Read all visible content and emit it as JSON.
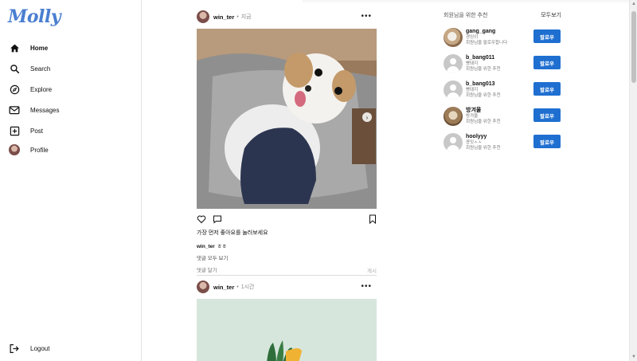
{
  "brand": {
    "logo": "Molly"
  },
  "sidebar": {
    "items": [
      {
        "label": "Home",
        "icon": "home-icon"
      },
      {
        "label": "Search",
        "icon": "search-icon"
      },
      {
        "label": "Explore",
        "icon": "compass-icon"
      },
      {
        "label": "Messages",
        "icon": "mail-icon"
      },
      {
        "label": "Post",
        "icon": "plus-square-icon"
      },
      {
        "label": "Profile",
        "icon": "avatar"
      }
    ],
    "logout": {
      "label": "Logout",
      "icon": "logout-icon"
    }
  },
  "posts": [
    {
      "username": "win_ter",
      "separator": "•",
      "time": "지금",
      "more": "•••",
      "likes_text": "가장 먼저 좋아요를 눌러보세요",
      "caption_user": "win_ter",
      "caption_text": "ㅎㅎ",
      "view_comments": "댓글 모두 보기",
      "comment_placeholder": "댓글 달기",
      "comment_post": "게시"
    },
    {
      "username": "win_ter",
      "separator": "•",
      "time": "1시간",
      "more": "•••"
    }
  ],
  "suggestions": {
    "title": "회원님을 위한 추천",
    "see_all": "모두보기",
    "follow_label": "팔로우",
    "items": [
      {
        "name": "gang_gang",
        "sub1": "경잉이",
        "sub2": "회원님을 팔로우합니다",
        "avatar": "photo1"
      },
      {
        "name": "b_bang011",
        "sub1": "빵돼지",
        "sub2": "회원님을 위한 추천",
        "avatar": "default"
      },
      {
        "name": "b_bang013",
        "sub1": "빵돼지",
        "sub2": "회원님을 위한 추천",
        "avatar": "default"
      },
      {
        "name": "방겨울",
        "sub1": "방겨울",
        "sub2": "회원님을 위한 추천",
        "avatar": "photo2"
      },
      {
        "name": "hoolyyy",
        "sub1": "콩잇ㅅㅅ",
        "sub2": "회원님을 위한 추천",
        "avatar": "default"
      }
    ]
  },
  "colors": {
    "accent": "#1f6fd1",
    "logo": "#4a7fd1"
  }
}
